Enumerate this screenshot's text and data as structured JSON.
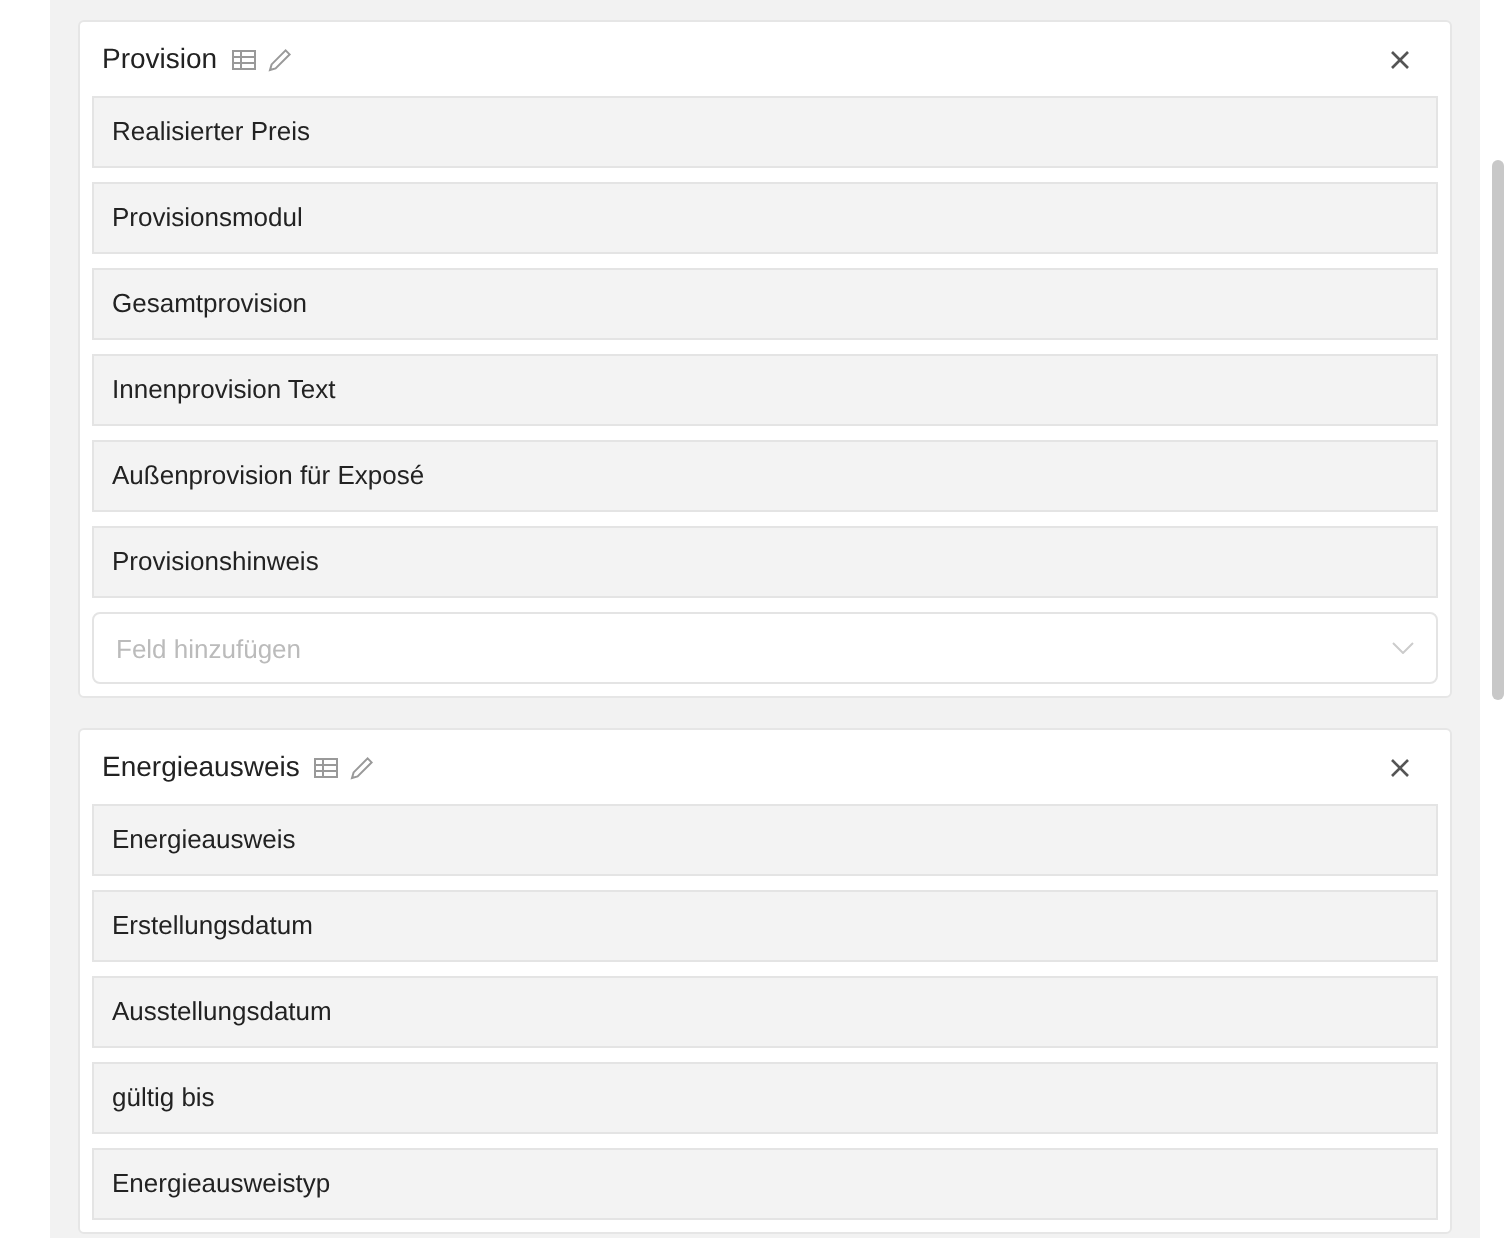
{
  "sections": [
    {
      "title": "Provision",
      "fields": [
        "Realisierter Preis",
        "Provisionsmodul",
        "Gesamtprovision",
        "Innenprovision Text",
        "Außenprovision für Exposé",
        "Provisionshinweis"
      ],
      "add_field": {
        "placeholder": "Feld hinzufügen"
      }
    },
    {
      "title": "Energieausweis",
      "fields": [
        "Energieausweis",
        "Erstellungsdatum",
        "Ausstellungsdatum",
        "gültig bis",
        "Energieausweistyp"
      ]
    }
  ]
}
